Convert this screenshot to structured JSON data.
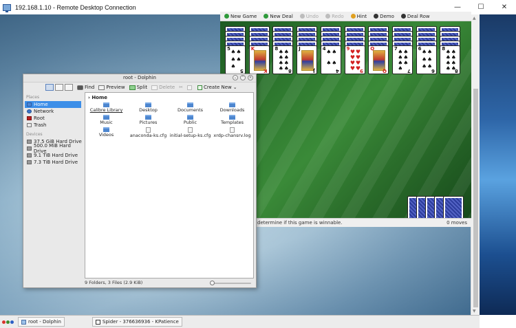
{
  "rdp": {
    "title": "192.168.1.10 - Remote Desktop Connection",
    "minimize": "—",
    "maximize": "☐",
    "close": "✕"
  },
  "kpatience": {
    "toolbar": [
      {
        "label": "New Game",
        "enabled": true,
        "icon_color": "#2e9a3a"
      },
      {
        "label": "New Deal",
        "enabled": true,
        "icon_color": "#2e9a3a"
      },
      {
        "label": "Undo",
        "enabled": false,
        "icon_color": "#bdbdbd"
      },
      {
        "label": "Redo",
        "enabled": false,
        "icon_color": "#bdbdbd"
      },
      {
        "label": "Hint",
        "enabled": true,
        "icon_color": "#e0a020"
      },
      {
        "label": "Demo",
        "enabled": true,
        "icon_color": "#333333"
      },
      {
        "label": "Deal Row",
        "enabled": true,
        "icon_color": "#333333"
      }
    ],
    "tableau": [
      {
        "top": {
          "rank": "5",
          "suit": "♠",
          "color": "black"
        }
      },
      {
        "top": {
          "rank": "K",
          "suit": "♦",
          "color": "red",
          "court": true
        }
      },
      {
        "top": {
          "rank": "8",
          "suit": "♠",
          "color": "black"
        }
      },
      {
        "top": {
          "rank": "J",
          "suit": "♠",
          "color": "black",
          "court": true
        }
      },
      {
        "top": {
          "rank": "4",
          "suit": "♠",
          "color": "black"
        }
      },
      {
        "top": {
          "rank": "9",
          "suit": "♥",
          "color": "red"
        }
      },
      {
        "top": {
          "rank": "Q",
          "suit": "♦",
          "color": "red",
          "court": true
        }
      },
      {
        "top": {
          "rank": "7",
          "suit": "♠",
          "color": "black"
        }
      },
      {
        "top": {
          "rank": "6",
          "suit": "♠",
          "color": "black"
        }
      },
      {
        "top": {
          "rank": "8",
          "suit": "♠",
          "color": "black"
        }
      }
    ],
    "status_message": "determine if this game is winnable.",
    "moves": "0 moves"
  },
  "dolphin": {
    "title": "root - Dolphin",
    "toolbar": {
      "find": "Find",
      "preview": "Preview",
      "split": "Split",
      "delete": "Delete",
      "create_new": "Create New"
    },
    "places_header": "Places",
    "places": [
      {
        "label": "Home",
        "icon": "home-icon",
        "active": true
      },
      {
        "label": "Network",
        "icon": "network-icon",
        "active": false
      },
      {
        "label": "Root",
        "icon": "root-folder-icon",
        "active": false
      },
      {
        "label": "Trash",
        "icon": "trash-icon",
        "active": false
      }
    ],
    "devices_header": "Devices",
    "devices": [
      {
        "label": "37.5 GiB Hard Drive"
      },
      {
        "label": "500.0 MiB Hard Drive"
      },
      {
        "label": "9.1 TiB Hard Drive"
      },
      {
        "label": "7.3 TiB Hard Drive"
      }
    ],
    "breadcrumb": "Home",
    "files": [
      {
        "name": "Calibre Library",
        "type": "folder"
      },
      {
        "name": "Desktop",
        "type": "folder"
      },
      {
        "name": "Documents",
        "type": "folder"
      },
      {
        "name": "Downloads",
        "type": "folder"
      },
      {
        "name": "Music",
        "type": "folder"
      },
      {
        "name": "Pictures",
        "type": "folder"
      },
      {
        "name": "Public",
        "type": "folder"
      },
      {
        "name": "Templates",
        "type": "folder"
      },
      {
        "name": "Videos",
        "type": "folder"
      },
      {
        "name": "anaconda-ks.cfg",
        "type": "file"
      },
      {
        "name": "initial-setup-ks.cfg",
        "type": "file"
      },
      {
        "name": "xrdp-chansrv.log",
        "type": "file"
      }
    ],
    "status": "9 Folders, 3 Files (2.9 KiB)"
  },
  "taskbar": {
    "items": [
      {
        "label": "root - Dolphin"
      },
      {
        "label": "Spider - 376636936 - KPatience"
      }
    ]
  },
  "colors": {
    "felt": "#2f7a30",
    "selection": "#3c8ee8",
    "card_back": "#2d3d9c"
  }
}
